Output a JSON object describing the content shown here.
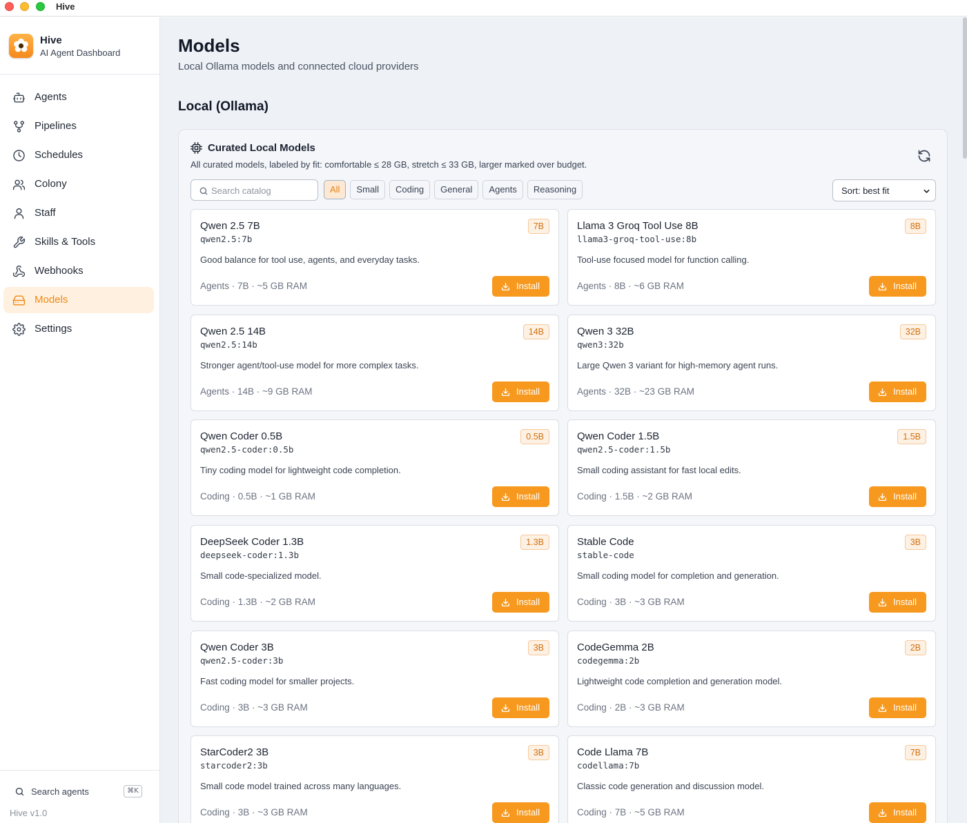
{
  "window": {
    "title": "Hive"
  },
  "brand": {
    "name": "Hive",
    "subtitle": "AI Agent Dashboard"
  },
  "nav": {
    "items": [
      {
        "label": "Agents",
        "icon": "bot-icon"
      },
      {
        "label": "Pipelines",
        "icon": "workflow-icon"
      },
      {
        "label": "Schedules",
        "icon": "clock-icon"
      },
      {
        "label": "Colony",
        "icon": "users-icon"
      },
      {
        "label": "Staff",
        "icon": "user-icon"
      },
      {
        "label": "Skills & Tools",
        "icon": "wrench-icon"
      },
      {
        "label": "Webhooks",
        "icon": "webhook-icon"
      },
      {
        "label": "Models",
        "icon": "hard-drive-icon",
        "active": true
      },
      {
        "label": "Settings",
        "icon": "gear-icon"
      }
    ]
  },
  "footer": {
    "search_label": "Search agents",
    "shortcut": "⌘K",
    "version": "Hive v1.0"
  },
  "page": {
    "title": "Models",
    "subtitle": "Local Ollama models and connected cloud providers",
    "section_title": "Local (Ollama)"
  },
  "panel": {
    "title": "Curated Local Models",
    "subtitle": "All curated models, labeled by fit: comfortable ≤ 28 GB, stretch ≤ 33 GB, larger marked over budget.",
    "search_placeholder": "Search catalog",
    "filters": [
      "All",
      "Small",
      "Coding",
      "General",
      "Agents",
      "Reasoning"
    ],
    "active_filter": "All",
    "sort_label": "Sort: best fit",
    "install_label": "Install"
  },
  "models": [
    {
      "name": "Qwen 2.5 7B",
      "tag": "qwen2.5:7b",
      "size": "7B",
      "desc": "Good balance for tool use, agents, and everyday tasks.",
      "meta": "Agents · 7B · ~5 GB RAM"
    },
    {
      "name": "Llama 3 Groq Tool Use 8B",
      "tag": "llama3-groq-tool-use:8b",
      "size": "8B",
      "desc": "Tool-use focused model for function calling.",
      "meta": "Agents · 8B · ~6 GB RAM"
    },
    {
      "name": "Qwen 2.5 14B",
      "tag": "qwen2.5:14b",
      "size": "14B",
      "desc": "Stronger agent/tool-use model for more complex tasks.",
      "meta": "Agents · 14B · ~9 GB RAM"
    },
    {
      "name": "Qwen 3 32B",
      "tag": "qwen3:32b",
      "size": "32B",
      "desc": "Large Qwen 3 variant for high-memory agent runs.",
      "meta": "Agents · 32B · ~23 GB RAM"
    },
    {
      "name": "Qwen Coder 0.5B",
      "tag": "qwen2.5-coder:0.5b",
      "size": "0.5B",
      "desc": "Tiny coding model for lightweight code completion.",
      "meta": "Coding · 0.5B · ~1 GB RAM"
    },
    {
      "name": "Qwen Coder 1.5B",
      "tag": "qwen2.5-coder:1.5b",
      "size": "1.5B",
      "desc": "Small coding assistant for fast local edits.",
      "meta": "Coding · 1.5B · ~2 GB RAM"
    },
    {
      "name": "DeepSeek Coder 1.3B",
      "tag": "deepseek-coder:1.3b",
      "size": "1.3B",
      "desc": "Small code-specialized model.",
      "meta": "Coding · 1.3B · ~2 GB RAM"
    },
    {
      "name": "Stable Code",
      "tag": "stable-code",
      "size": "3B",
      "desc": "Small coding model for completion and generation.",
      "meta": "Coding · 3B · ~3 GB RAM"
    },
    {
      "name": "Qwen Coder 3B",
      "tag": "qwen2.5-coder:3b",
      "size": "3B",
      "desc": "Fast coding model for smaller projects.",
      "meta": "Coding · 3B · ~3 GB RAM"
    },
    {
      "name": "CodeGemma 2B",
      "tag": "codegemma:2b",
      "size": "2B",
      "desc": "Lightweight code completion and generation model.",
      "meta": "Coding · 2B · ~3 GB RAM"
    },
    {
      "name": "StarCoder2 3B",
      "tag": "starcoder2:3b",
      "size": "3B",
      "desc": "Small code model trained across many languages.",
      "meta": "Coding · 3B · ~3 GB RAM"
    },
    {
      "name": "Code Llama 7B",
      "tag": "codellama:7b",
      "size": "7B",
      "desc": "Classic code generation and discussion model.",
      "meta": "Coding · 7B · ~5 GB RAM"
    }
  ]
}
